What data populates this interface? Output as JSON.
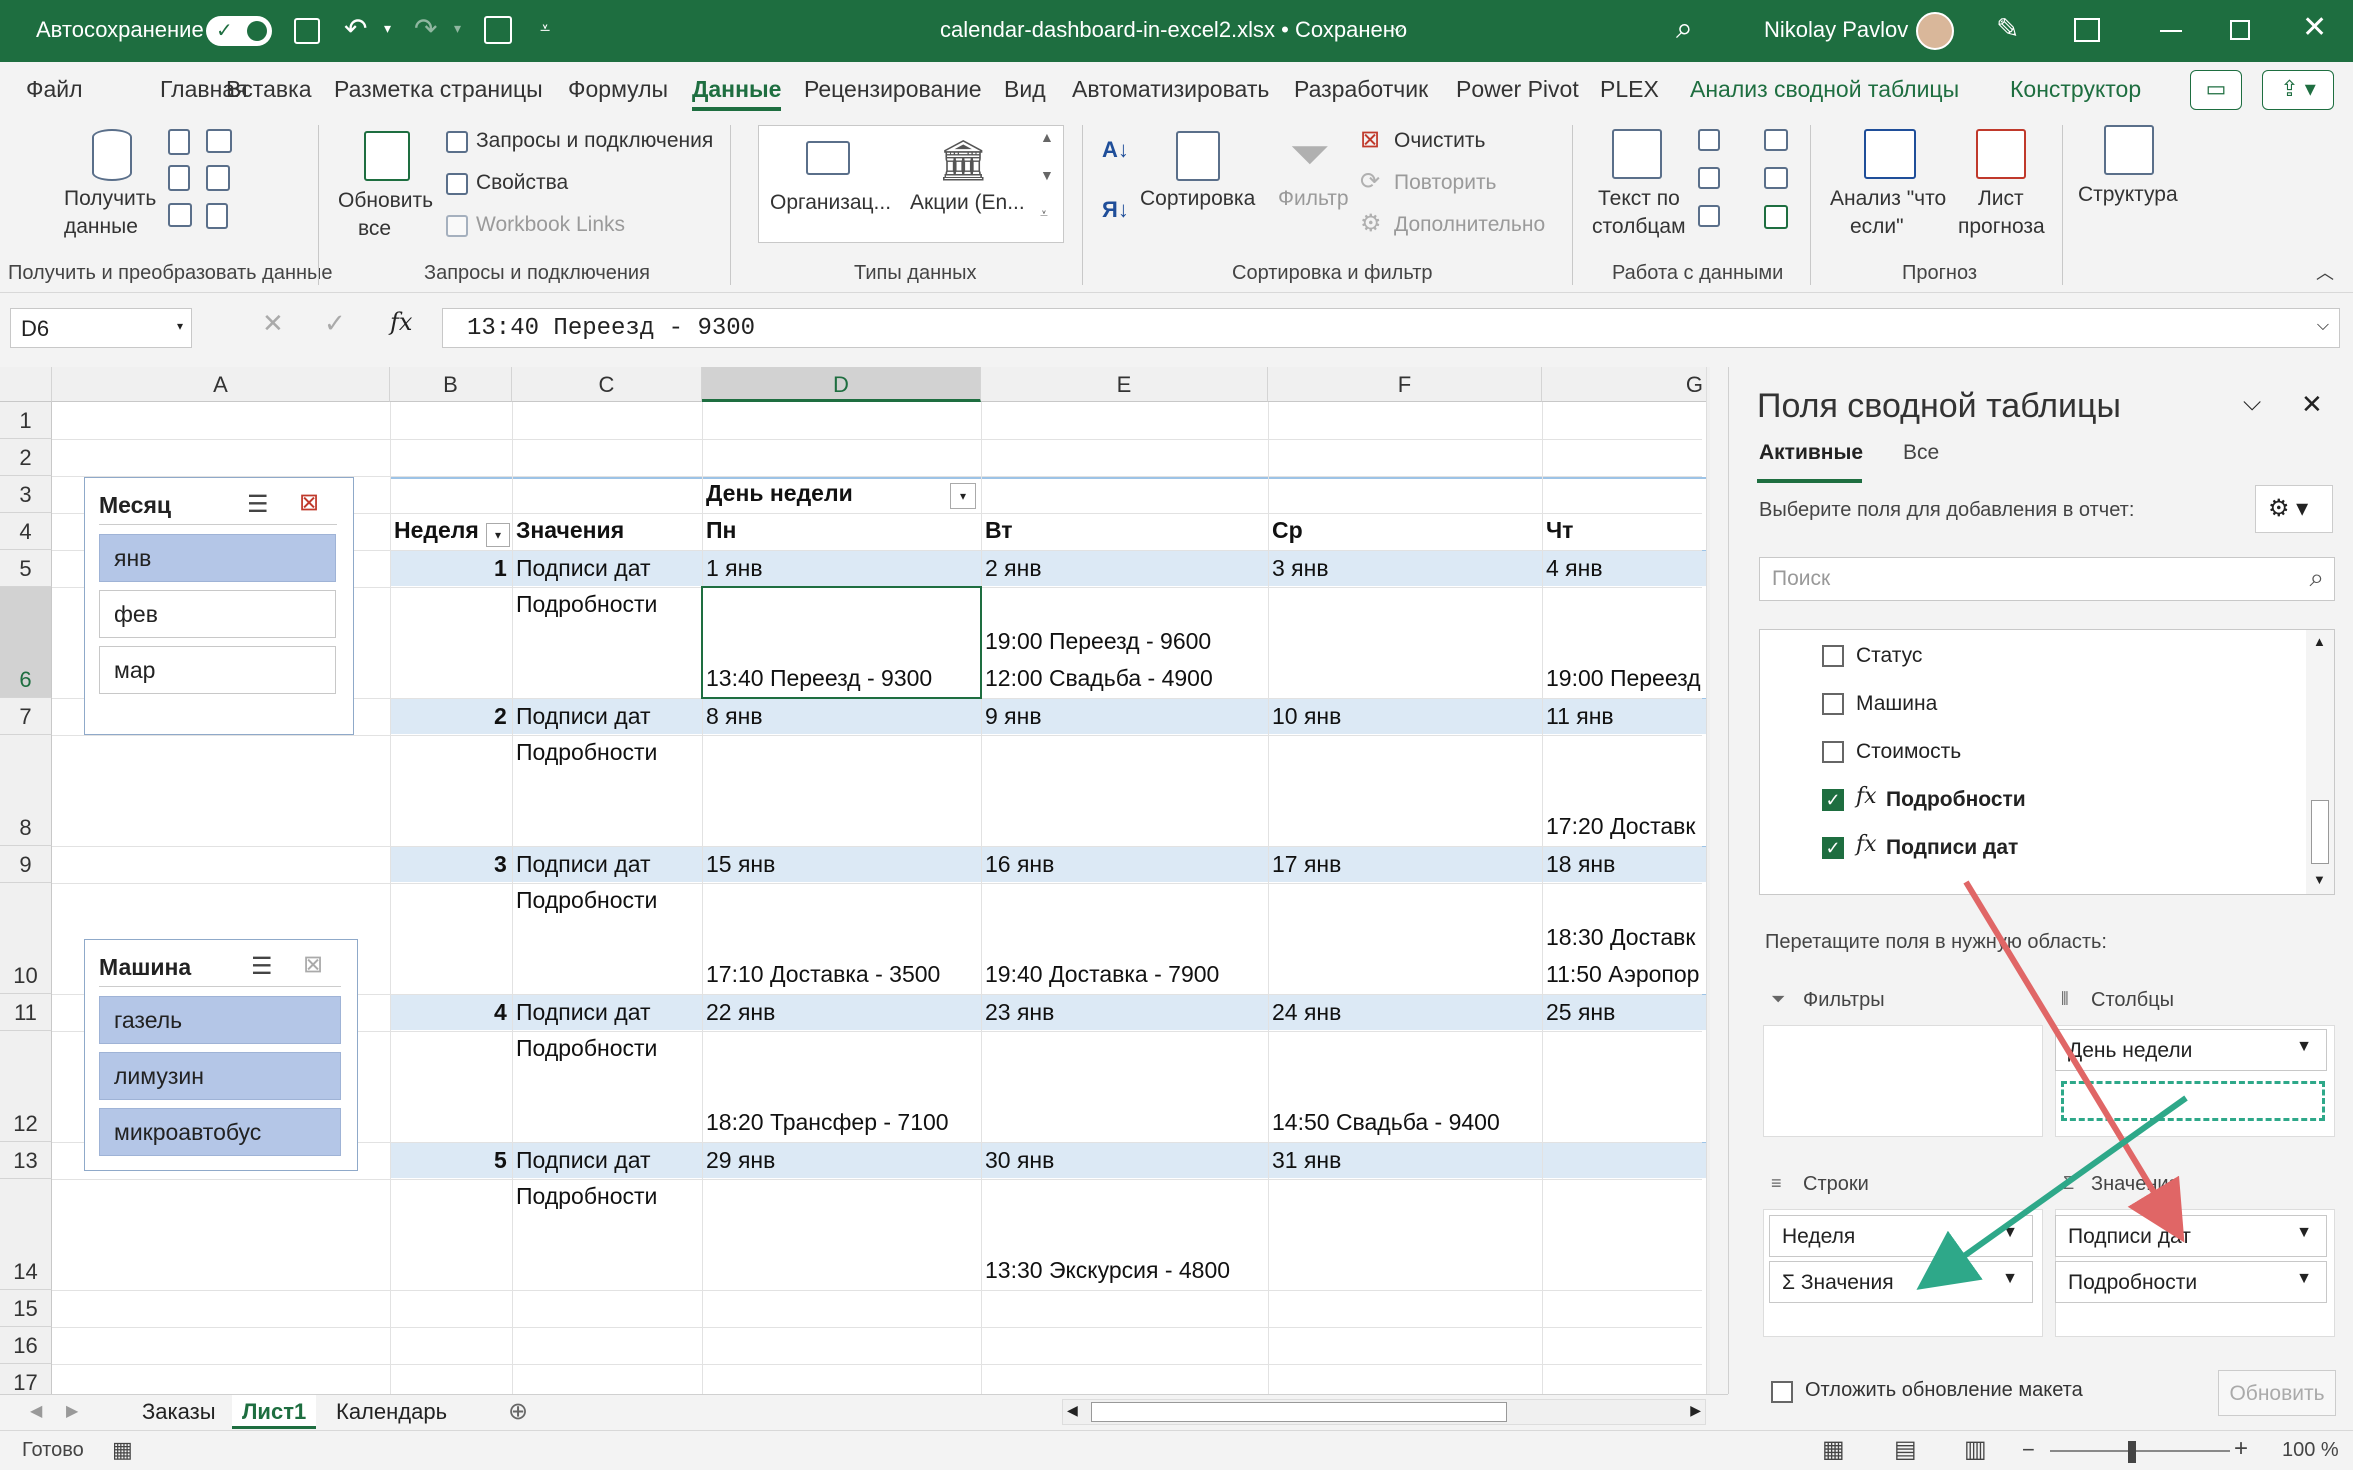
{
  "titlebar": {
    "autosave_label": "Автосохранение",
    "file_title": "calendar-dashboard-in-excel2.xlsx • Сохранено",
    "user_name": "Nikolay Pavlov"
  },
  "tabs": [
    "Файл",
    "Главная",
    "Вставка",
    "Разметка страницы",
    "Формулы",
    "Данные",
    "Рецензирование",
    "Вид",
    "Автоматизировать",
    "Разработчик",
    "Power Pivot",
    "PLEX",
    "Анализ сводной таблицы",
    "Конструктор"
  ],
  "ribbon": {
    "get_data": "Получить",
    "get_data2": "данные",
    "refresh_all": "Обновить",
    "refresh_all2": "все",
    "queries_connections": "Запросы и подключения",
    "properties": "Свойства",
    "workbook_links": "Workbook Links",
    "dt_org": "Организац...",
    "dt_stocks": "Акции (En...",
    "sort": "Сортировка",
    "filter": "Фильтр",
    "clear": "Очистить",
    "reapply": "Повторить",
    "advanced": "Дополнительно",
    "text_to_columns": "Текст по",
    "text_to_columns2": "столбцам",
    "what_if": "Анализ \"что",
    "what_if2": "если\"",
    "forecast": "Лист",
    "forecast2": "прогноза",
    "outline": "Структура",
    "groups": {
      "get_transform": "Получить и преобразовать данные",
      "queries": "Запросы и подключения",
      "data_types": "Типы данных",
      "sort_filter": "Сортировка и фильтр",
      "data_tools": "Работа с данными",
      "forecast": "Прогноз"
    }
  },
  "formula_bar": {
    "name_box": "D6",
    "formula": "13:40 Переезд - 9300"
  },
  "grid": {
    "columns": [
      "A",
      "B",
      "C",
      "D",
      "E",
      "F",
      "G"
    ],
    "rows": [
      "1",
      "2",
      "3",
      "4",
      "5",
      "6",
      "7",
      "8",
      "9",
      "10",
      "11",
      "12",
      "13",
      "14",
      "15",
      "16",
      "17"
    ],
    "pivot": {
      "col_field": "День недели",
      "row_field": "Неделя",
      "values_header": "Значения",
      "days": [
        "Пн",
        "Вт",
        "Ср",
        "Чт"
      ],
      "label_dates": "Подписи дат",
      "label_details": "Подробности",
      "weeks": [
        {
          "n": "1",
          "dates": [
            "1 янв",
            "2 янв",
            "3 янв",
            "4 янв"
          ],
          "details": [
            [
              "13:40 Переезд - 9300"
            ],
            [
              "19:00 Переезд - 9600",
              "12:00 Свадьба - 4900"
            ],
            [],
            [
              "19:00 Переезд"
            ]
          ]
        },
        {
          "n": "2",
          "dates": [
            "8 янв",
            "9 янв",
            "10 янв",
            "11 янв"
          ],
          "details": [
            [],
            [],
            [],
            [
              "17:20 Доставк"
            ]
          ]
        },
        {
          "n": "3",
          "dates": [
            "15 янв",
            "16 янв",
            "17 янв",
            "18 янв"
          ],
          "details": [
            [
              "17:10 Доставка - 3500"
            ],
            [
              "19:40 Доставка - 7900"
            ],
            [],
            [
              "18:30 Доставк",
              "11:50 Аэропор"
            ]
          ]
        },
        {
          "n": "4",
          "dates": [
            "22 янв",
            "23 янв",
            "24 янв",
            "25 янв"
          ],
          "details": [
            [
              "18:20 Трансфер - 7100"
            ],
            [],
            [
              "14:50 Свадьба - 9400"
            ],
            []
          ]
        },
        {
          "n": "5",
          "dates": [
            "29 янв",
            "30 янв",
            "31 янв",
            ""
          ],
          "details": [
            [],
            [
              "13:30 Экскурсия - 4800"
            ],
            [],
            []
          ]
        }
      ]
    }
  },
  "slicers": {
    "month": {
      "title": "Месяц",
      "items": [
        {
          "label": "янв",
          "on": true
        },
        {
          "label": "фев",
          "on": false
        },
        {
          "label": "мар",
          "on": false
        }
      ]
    },
    "car": {
      "title": "Машина",
      "items": [
        {
          "label": "газель",
          "on": true
        },
        {
          "label": "лимузин",
          "on": true
        },
        {
          "label": "микроавтобус",
          "on": true
        }
      ]
    }
  },
  "panel": {
    "title": "Поля сводной таблицы",
    "tab_active": "Активные",
    "tab_all": "Все",
    "choose_fields": "Выберите поля для добавления в отчет:",
    "search_placeholder": "Поиск",
    "fields": [
      {
        "label": "Статус",
        "checked": false,
        "fx": false
      },
      {
        "label": "Машина",
        "checked": false,
        "fx": false
      },
      {
        "label": "Стоимость",
        "checked": false,
        "fx": false
      },
      {
        "label": "Подробности",
        "checked": true,
        "fx": true
      },
      {
        "label": "Подписи дат",
        "checked": true,
        "fx": true
      }
    ],
    "drag_hint": "Перетащите поля в нужную область:",
    "filters_label": "Фильтры",
    "columns_label": "Столбцы",
    "rows_label": "Строки",
    "values_label": "Значения",
    "columns_items": [
      "День недели"
    ],
    "rows_items": [
      "Неделя",
      "Σ Значения"
    ],
    "values_items": [
      "Подписи дат",
      "Подробности"
    ],
    "defer_label": "Отложить обновление макета",
    "update_button": "Обновить"
  },
  "sheet_tabs": [
    "Заказы",
    "Лист1",
    "Календарь"
  ],
  "status": {
    "ready": "Готово",
    "zoom": "100 %"
  },
  "colors": {
    "excel_green": "#1e6e40",
    "band": "#dce9f5",
    "slicer_on": "#b4c6e7",
    "arrow_red": "#e06666",
    "arrow_teal": "#2ea889"
  }
}
